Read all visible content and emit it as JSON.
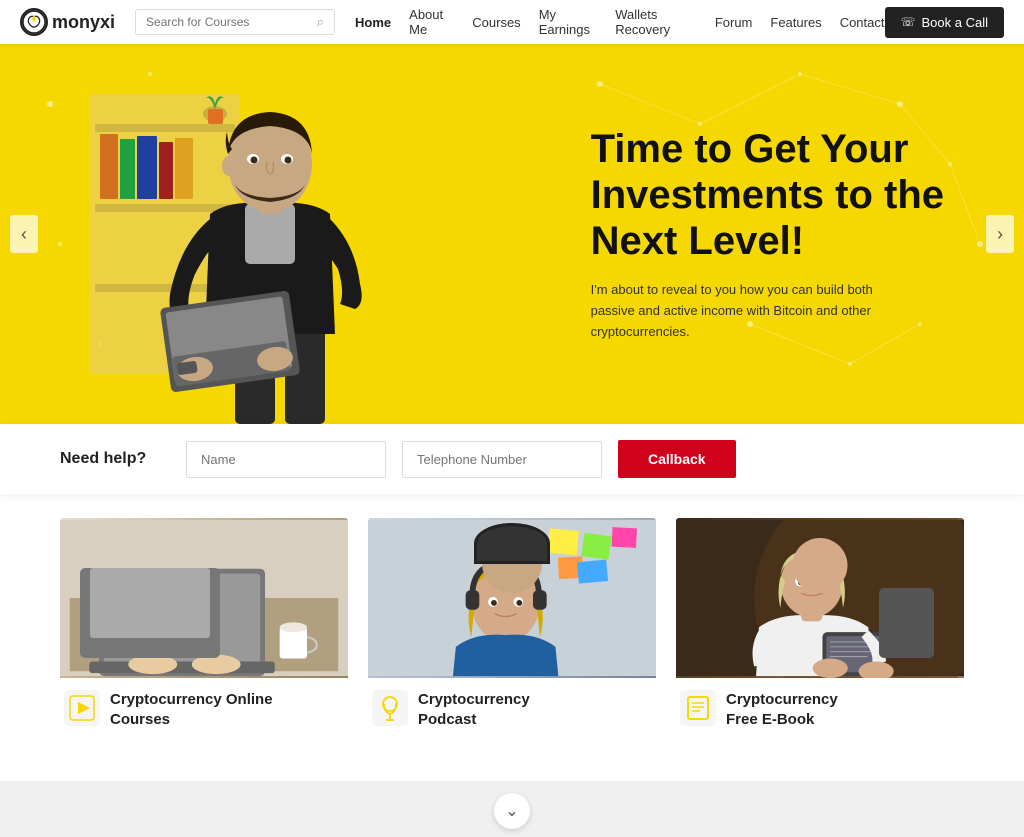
{
  "brand": {
    "logo_text": "monyxi",
    "logo_icon": "m"
  },
  "navbar": {
    "search_placeholder": "Search for Courses",
    "links": [
      {
        "label": "Home",
        "active": true
      },
      {
        "label": "About Me"
      },
      {
        "label": "Courses"
      },
      {
        "label": "My Earnings"
      },
      {
        "label": "Wallets Recovery"
      },
      {
        "label": "Forum"
      },
      {
        "label": "Features"
      },
      {
        "label": "Contact"
      }
    ],
    "book_btn": "Book a Call"
  },
  "hero": {
    "title_line1": "Time to Get Your",
    "title_line2": "Investments to the",
    "title_line3": "Next Level!",
    "subtitle": "I'm about to reveal to you how you can build both passive and active income with Bitcoin and other cryptocurrencies."
  },
  "callback": {
    "label": "Need help?",
    "name_placeholder": "Name",
    "phone_placeholder": "Telephone Number",
    "btn_label": "Callback"
  },
  "cards": [
    {
      "icon": "▶",
      "title_line1": "Cryptocurrency Online",
      "title_line2": "Courses",
      "img_class": "card-img-1"
    },
    {
      "icon": "🎧",
      "title_line1": "Cryptocurrency",
      "title_line2": "Podcast",
      "img_class": "card-img-2"
    },
    {
      "icon": "📖",
      "title_line1": "Cryptocurrency",
      "title_line2": "Free E-Book",
      "img_class": "card-img-3"
    }
  ]
}
